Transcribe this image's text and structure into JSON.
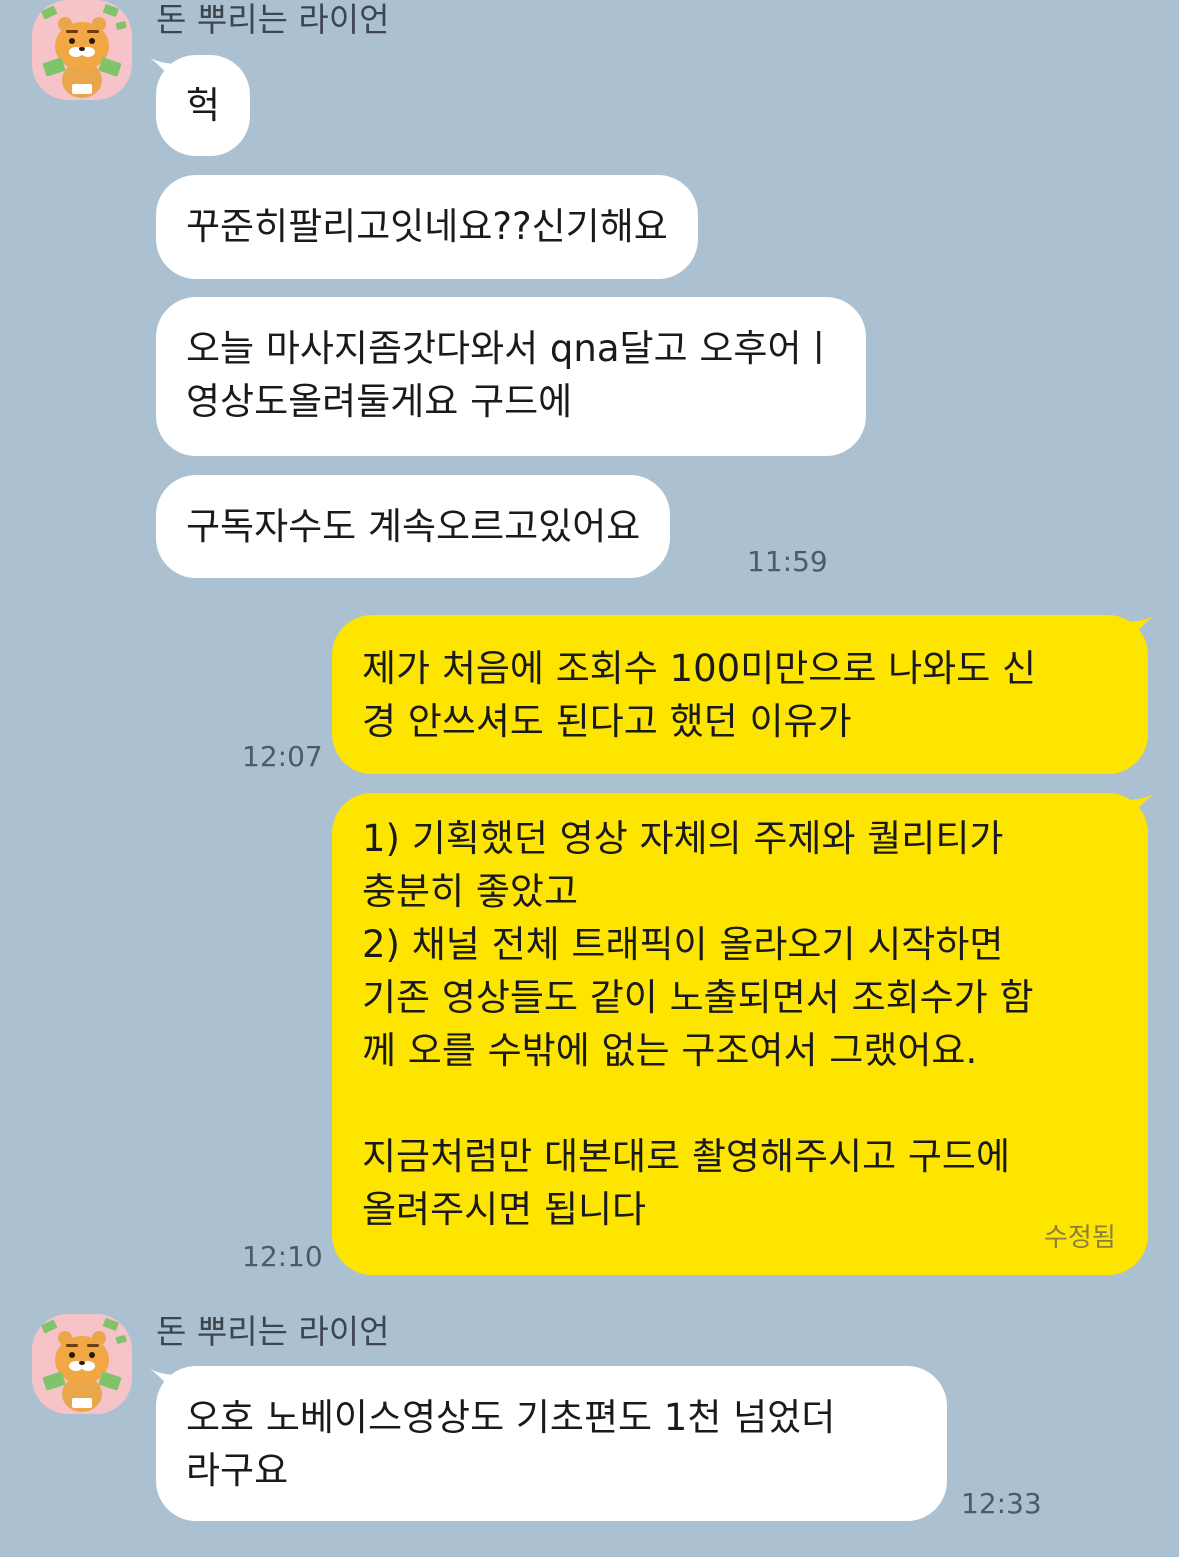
{
  "sender": {
    "name": "돈 뿌리는 라이언"
  },
  "group1": {
    "messages": [
      "헉",
      "꾸준히팔리고잇네요??신기해요",
      "오늘 마사지좀갓다와서 qna달고 오후어ㅣ\n영상도올려둘게요 구드에",
      "구독자수도 계속오르고있어요"
    ],
    "time": "11:59"
  },
  "outgoing": [
    {
      "text": "제가 처음에 조회수 100미만으로 나와도 신\n경 안쓰셔도 된다고 했던 이유가",
      "time": "12:07"
    },
    {
      "text": "1) 기획했던 영상 자체의 주제와 퀄리티가\n충분히 좋았고\n2) 채널 전체 트래픽이 올라오기 시작하면\n기존 영상들도 같이 노출되면서 조회수가 함\n께 오를 수밖에 없는 구조여서 그랬어요.\n\n지금처럼만 대본대로 촬영해주시고 구드에\n올려주시면 됩니다",
      "time": "12:10",
      "edited_label": "수정됨"
    }
  ],
  "group2": {
    "messages": [
      "오호 노베이스영상도 기초편도 1천 넘었더\n라구요"
    ],
    "time": "12:33"
  },
  "colors": {
    "background": "#abc1d1",
    "incoming_bubble": "#ffffff",
    "outgoing_bubble": "#fee500",
    "avatar_bg": "#f6c3c8"
  },
  "icons": {
    "avatar": "ryan-money-avatar-icon"
  }
}
